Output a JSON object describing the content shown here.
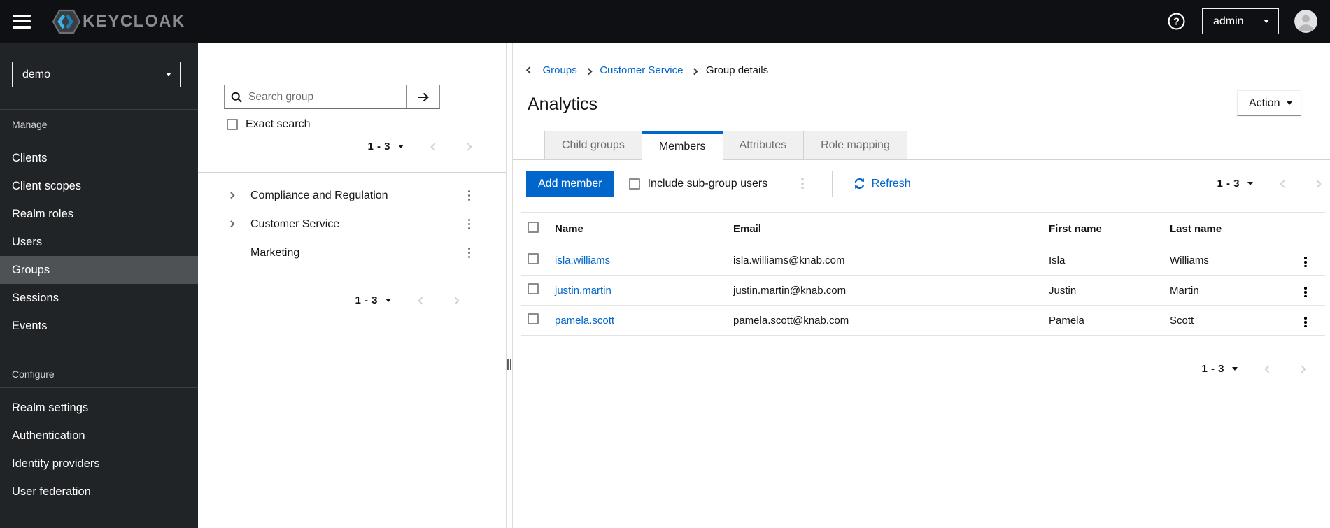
{
  "colors": {
    "accent": "#0066cc",
    "masthead_bg": "#0e1013",
    "nav_bg": "#212427",
    "nav_selected_bg": "#4f5255",
    "link": "#0066cc"
  },
  "masthead": {
    "brand": "KEYCLOAK",
    "user": "admin"
  },
  "sidebar": {
    "realm": "demo",
    "selected": "Groups",
    "sections": [
      {
        "label": "Manage",
        "items": [
          "Clients",
          "Client scopes",
          "Realm roles",
          "Users",
          "Groups",
          "Sessions",
          "Events"
        ]
      },
      {
        "label": "Configure",
        "items": [
          "Realm settings",
          "Authentication",
          "Identity providers",
          "User federation"
        ]
      }
    ]
  },
  "group_panel": {
    "search_placeholder": "Search group",
    "exact_search": "Exact search",
    "pagination_range": "1 - 3",
    "tree": [
      "Compliance and Regulation",
      "Customer Service",
      "Marketing"
    ],
    "tree_pagination_range": "1 - 3"
  },
  "main": {
    "breadcrumb": {
      "items": [
        "Groups",
        "Customer Service"
      ],
      "current": "Group details"
    },
    "title": "Analytics",
    "action": "Action",
    "tabs": [
      "Child groups",
      "Members",
      "Attributes",
      "Role mapping"
    ],
    "active_tab": "Members",
    "toolbar": {
      "add_member": "Add member",
      "include_subgroups": "Include sub-group users",
      "refresh": "Refresh",
      "pagination_range": "1 - 3"
    },
    "table": {
      "headers": [
        "Name",
        "Email",
        "First name",
        "Last name"
      ],
      "rows": [
        {
          "name": "isla.williams",
          "email": "isla.williams@knab.com",
          "first_name": "Isla",
          "last_name": "Williams"
        },
        {
          "name": "justin.martin",
          "email": "justin.martin@knab.com",
          "first_name": "Justin",
          "last_name": "Martin"
        },
        {
          "name": "pamela.scott",
          "email": "pamela.scott@knab.com",
          "first_name": "Pamela",
          "last_name": "Scott"
        }
      ]
    },
    "bottom_pagination_range": "1 - 3"
  }
}
